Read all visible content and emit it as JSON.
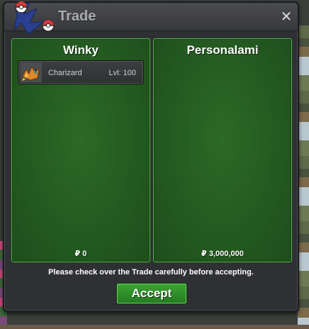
{
  "window": {
    "title": "Trade",
    "close_icon": "close-icon"
  },
  "colors": {
    "panel_green": "#245a20",
    "panel_border": "#52b64a",
    "accept_green": "#2f8f29",
    "window_bg": "#2f3033"
  },
  "left_panel": {
    "player_name": "Winky",
    "money": "₽ 0",
    "items": [
      {
        "pokemon": "Charizard",
        "level": "Lvl: 100",
        "icon": "charizard-sprite-icon"
      }
    ]
  },
  "right_panel": {
    "player_name": "Personalami",
    "money": "₽ 3,000,000",
    "items": []
  },
  "notice": "Please check over the Trade carefully before accepting.",
  "accept_label": "Accept"
}
